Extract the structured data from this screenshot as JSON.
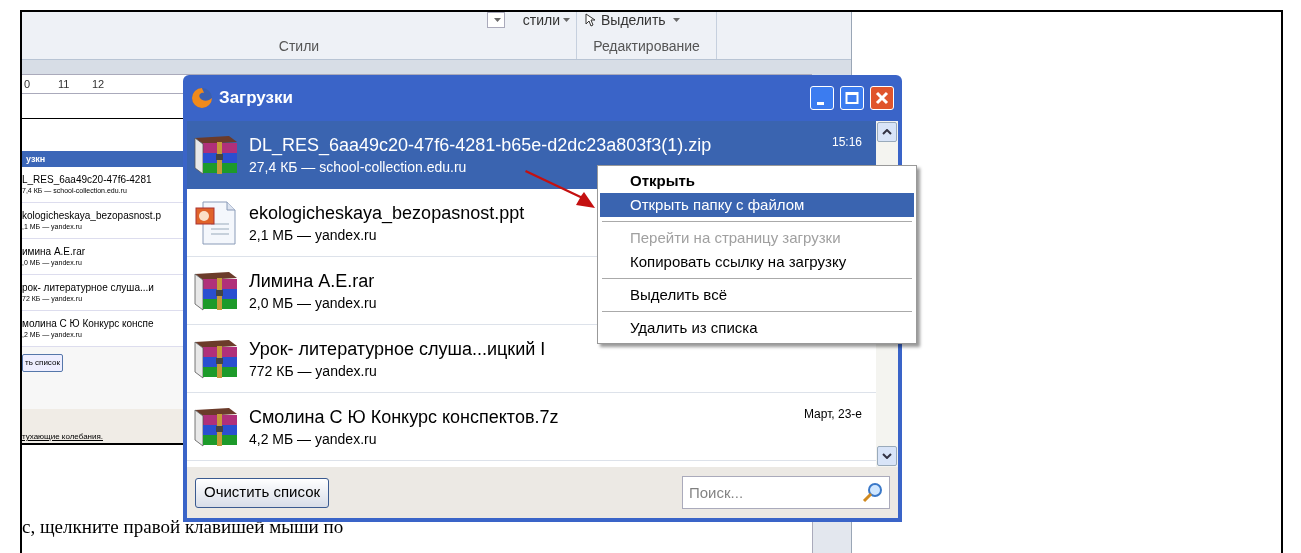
{
  "word": {
    "ribbon": {
      "styles_button": "стили",
      "select_button": "Выделить",
      "groups": [
        "Стили",
        "Редактирование"
      ]
    },
    "ruler": [
      "0",
      "11",
      "12"
    ],
    "embedded_screenshot": {
      "title": "узкн",
      "items": [
        {
          "name": "L_RES_6aa49c20-47f6-4281",
          "info": "7,4 КБ — school-collection.edu.ru"
        },
        {
          "name": "kologicheskaya_bezopasnost.p",
          "info": ",1 МБ — yandex.ru"
        },
        {
          "name": "имина А.E.rar",
          "info": ",0 МБ — yandex.ru"
        },
        {
          "name": "рок- литературное слуша...и",
          "info": "72 КБ — yandex.ru"
        },
        {
          "name": "молина С Ю Конкурс конспе",
          "info": ",2 МБ — yandex.ru"
        }
      ],
      "button": "ть список",
      "link": "тухающие колебания."
    },
    "body_text": "с, щелкните правой клавишей мыши по"
  },
  "downloads": {
    "title": "Загрузки",
    "items": [
      {
        "kind": "archive",
        "name": "DL_RES_6aa49c20-47f6-4281-b65e-d2dc23a803f3(1).zip",
        "info": "27,4 КБ — school-collection.edu.ru",
        "time": "15:16",
        "selected": true
      },
      {
        "kind": "presentation",
        "name": "ekologicheskaya_bezopasnost.ppt",
        "info": "2,1 МБ — yandex.ru",
        "selected": false
      },
      {
        "kind": "archive",
        "name": "Лимина А.E.rar",
        "info": "2,0 МБ — yandex.ru",
        "selected": false
      },
      {
        "kind": "archive",
        "name": "Урок- литературное слуша...ицкий I",
        "info": "772 КБ — yandex.ru",
        "selected": false
      },
      {
        "kind": "archive",
        "name": "Смолина С Ю Конкурс конспектов.7z",
        "info": "4,2 МБ — yandex.ru",
        "time": "Март, 23-е",
        "selected": false
      }
    ],
    "clear_button": "Очистить список",
    "search": {
      "placeholder": "Поиск..."
    }
  },
  "context_menu": {
    "items": [
      {
        "label": "Открыть",
        "bold": true,
        "disabled": false,
        "selected": false,
        "separator_after": false
      },
      {
        "label": "Открыть папку с файлом",
        "bold": false,
        "disabled": false,
        "selected": true,
        "separator_after": true
      },
      {
        "label": "Перейти на страницу загрузки",
        "bold": false,
        "disabled": true,
        "selected": false,
        "separator_after": false
      },
      {
        "label": "Копировать ссылку на загрузку",
        "bold": false,
        "disabled": false,
        "selected": false,
        "separator_after": true
      },
      {
        "label": "Выделить всё",
        "bold": false,
        "disabled": false,
        "selected": false,
        "separator_after": true
      },
      {
        "label": "Удалить из списка",
        "bold": false,
        "disabled": false,
        "selected": false,
        "separator_after": false
      }
    ]
  }
}
